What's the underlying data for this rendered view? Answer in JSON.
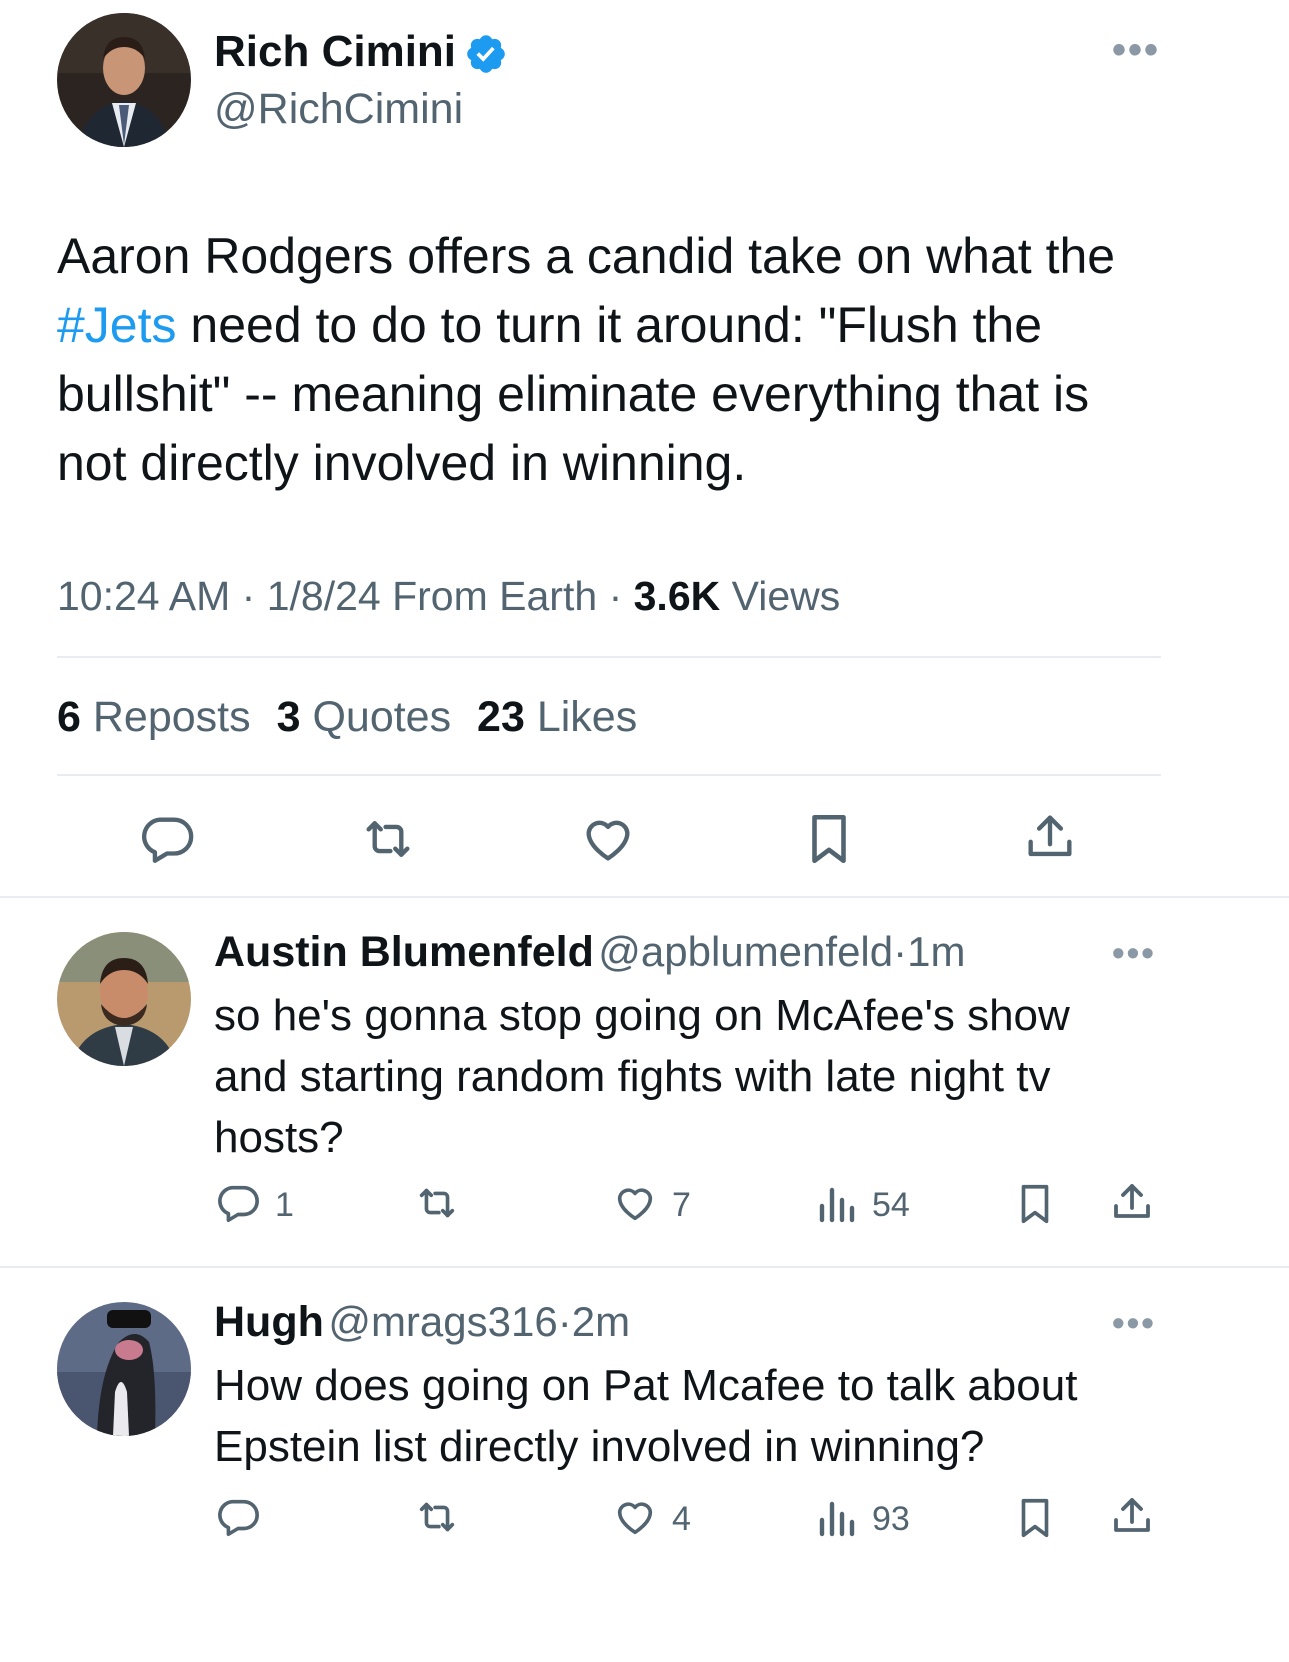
{
  "main_tweet": {
    "author": {
      "name": "Rich Cimini",
      "handle": "@RichCimini",
      "verified": true
    },
    "text_before_tag": "Aaron Rodgers offers a candid take on what the ",
    "hashtag": "#Jets",
    "text_after_tag": " need to do to turn it around: \"Flush the bullshit\" -- meaning eliminate everything that is not directly involved in winning.",
    "meta": {
      "time": "10:24 AM",
      "sep1": "·",
      "date": "1/8/24",
      "source": "From Earth",
      "sep2": "·",
      "views_count": "3.6K",
      "views_label": "Views"
    },
    "stats": {
      "reposts_count": "6",
      "reposts_label": "Reposts",
      "quotes_count": "3",
      "quotes_label": "Quotes",
      "likes_count": "23",
      "likes_label": "Likes"
    }
  },
  "replies": [
    {
      "name": "Austin Blumenfeld",
      "handle": "@apblumenfeld",
      "sep": "·",
      "time": "1m",
      "text": "so he's gonna stop going on McAfee's show and starting random fights with late night tv hosts?",
      "reply_count": "1",
      "like_count": "7",
      "view_count": "54"
    },
    {
      "name": "Hugh",
      "handle": "@mrags316",
      "sep": "·",
      "time": "2m",
      "text": "How does going on Pat Mcafee to talk about Epstein list directly involved in winning?",
      "like_count": "4",
      "view_count": "93"
    }
  ],
  "more_label": "•••",
  "colors": {
    "accent": "#1d9bf0",
    "secondary_text": "#536471",
    "divider": "#e6ecf0"
  },
  "icons": [
    "verified-badge-icon",
    "reply-icon",
    "repost-icon",
    "like-icon",
    "bookmark-icon",
    "share-icon",
    "views-icon",
    "more-icon"
  ]
}
